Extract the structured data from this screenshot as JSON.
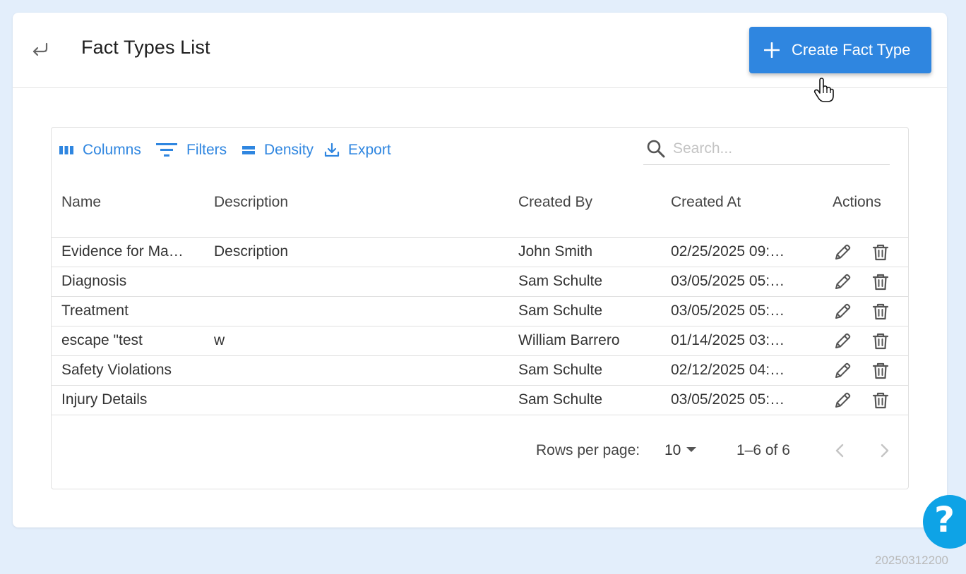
{
  "header": {
    "title": "Fact Types List",
    "create_button_label": "Create Fact Type"
  },
  "toolbar": {
    "columns_label": "Columns",
    "filters_label": "Filters",
    "density_label": "Density",
    "export_label": "Export",
    "search_placeholder": "Search..."
  },
  "table": {
    "columns": [
      "Name",
      "Description",
      "Created By",
      "Created At",
      "Actions"
    ],
    "rows": [
      {
        "name": "Evidence for Ma…",
        "description": "Description",
        "created_by": "John Smith",
        "created_at": "02/25/2025 09:…"
      },
      {
        "name": "Diagnosis",
        "description": "",
        "created_by": "Sam Schulte",
        "created_at": "03/05/2025 05:…"
      },
      {
        "name": "Treatment",
        "description": "",
        "created_by": "Sam Schulte",
        "created_at": "03/05/2025 05:…"
      },
      {
        "name": "escape \"test",
        "description": "w",
        "created_by": "William Barrero",
        "created_at": "01/14/2025 03:…"
      },
      {
        "name": "Safety Violations",
        "description": "",
        "created_by": "Sam Schulte",
        "created_at": "02/12/2025 04:…"
      },
      {
        "name": "Injury Details",
        "description": "",
        "created_by": "Sam Schulte",
        "created_at": "03/05/2025 05:…"
      }
    ]
  },
  "pagination": {
    "rows_per_page_label": "Rows per page:",
    "rows_per_page_value": "10",
    "range_label": "1–6 of 6"
  },
  "help_button_label": "?",
  "build_id": "20250312200"
}
